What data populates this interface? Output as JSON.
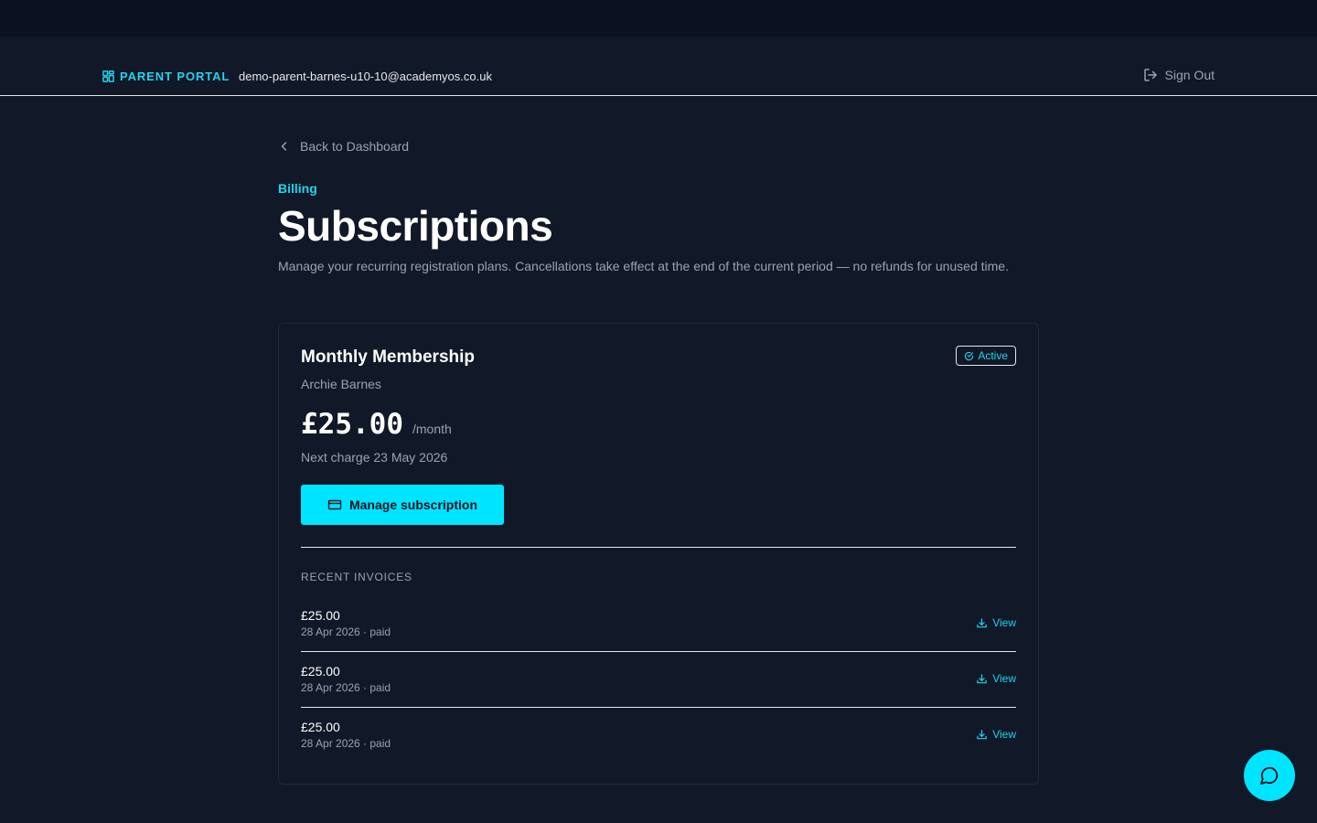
{
  "header": {
    "brand_label": "PARENT PORTAL",
    "user_email": "demo-parent-barnes-u10-10@academyos.co.uk",
    "sign_out_label": "Sign Out"
  },
  "nav": {
    "back_label": "Back to Dashboard"
  },
  "page": {
    "eyebrow": "Billing",
    "title": "Subscriptions",
    "description": "Manage your recurring registration plans. Cancellations take effect at the end of the current period — no refunds for unused time."
  },
  "subscription": {
    "plan_name": "Monthly Membership",
    "status": "Active",
    "child_name": "Archie Barnes",
    "price": "£25.00",
    "period": "/month",
    "next_charge": "Next charge 23 May 2026",
    "manage_label": "Manage subscription"
  },
  "invoices": {
    "section_label": "RECENT INVOICES",
    "items": [
      {
        "amount": "£25.00",
        "meta": "28 Apr 2026 · paid",
        "action": "View"
      },
      {
        "amount": "£25.00",
        "meta": "28 Apr 2026 · paid",
        "action": "View"
      },
      {
        "amount": "£25.00",
        "meta": "28 Apr 2026 · paid",
        "action": "View"
      }
    ]
  },
  "colors": {
    "accent": "#22d3ee",
    "button": "#00e5ff",
    "background": "#111827"
  },
  "icons": {
    "brand": "grid-icon",
    "sign_out": "logout-icon",
    "back": "chevron-left-icon",
    "status": "check-circle-icon",
    "manage": "credit-card-icon",
    "view": "download-icon",
    "chat": "chat-bubble-icon"
  }
}
